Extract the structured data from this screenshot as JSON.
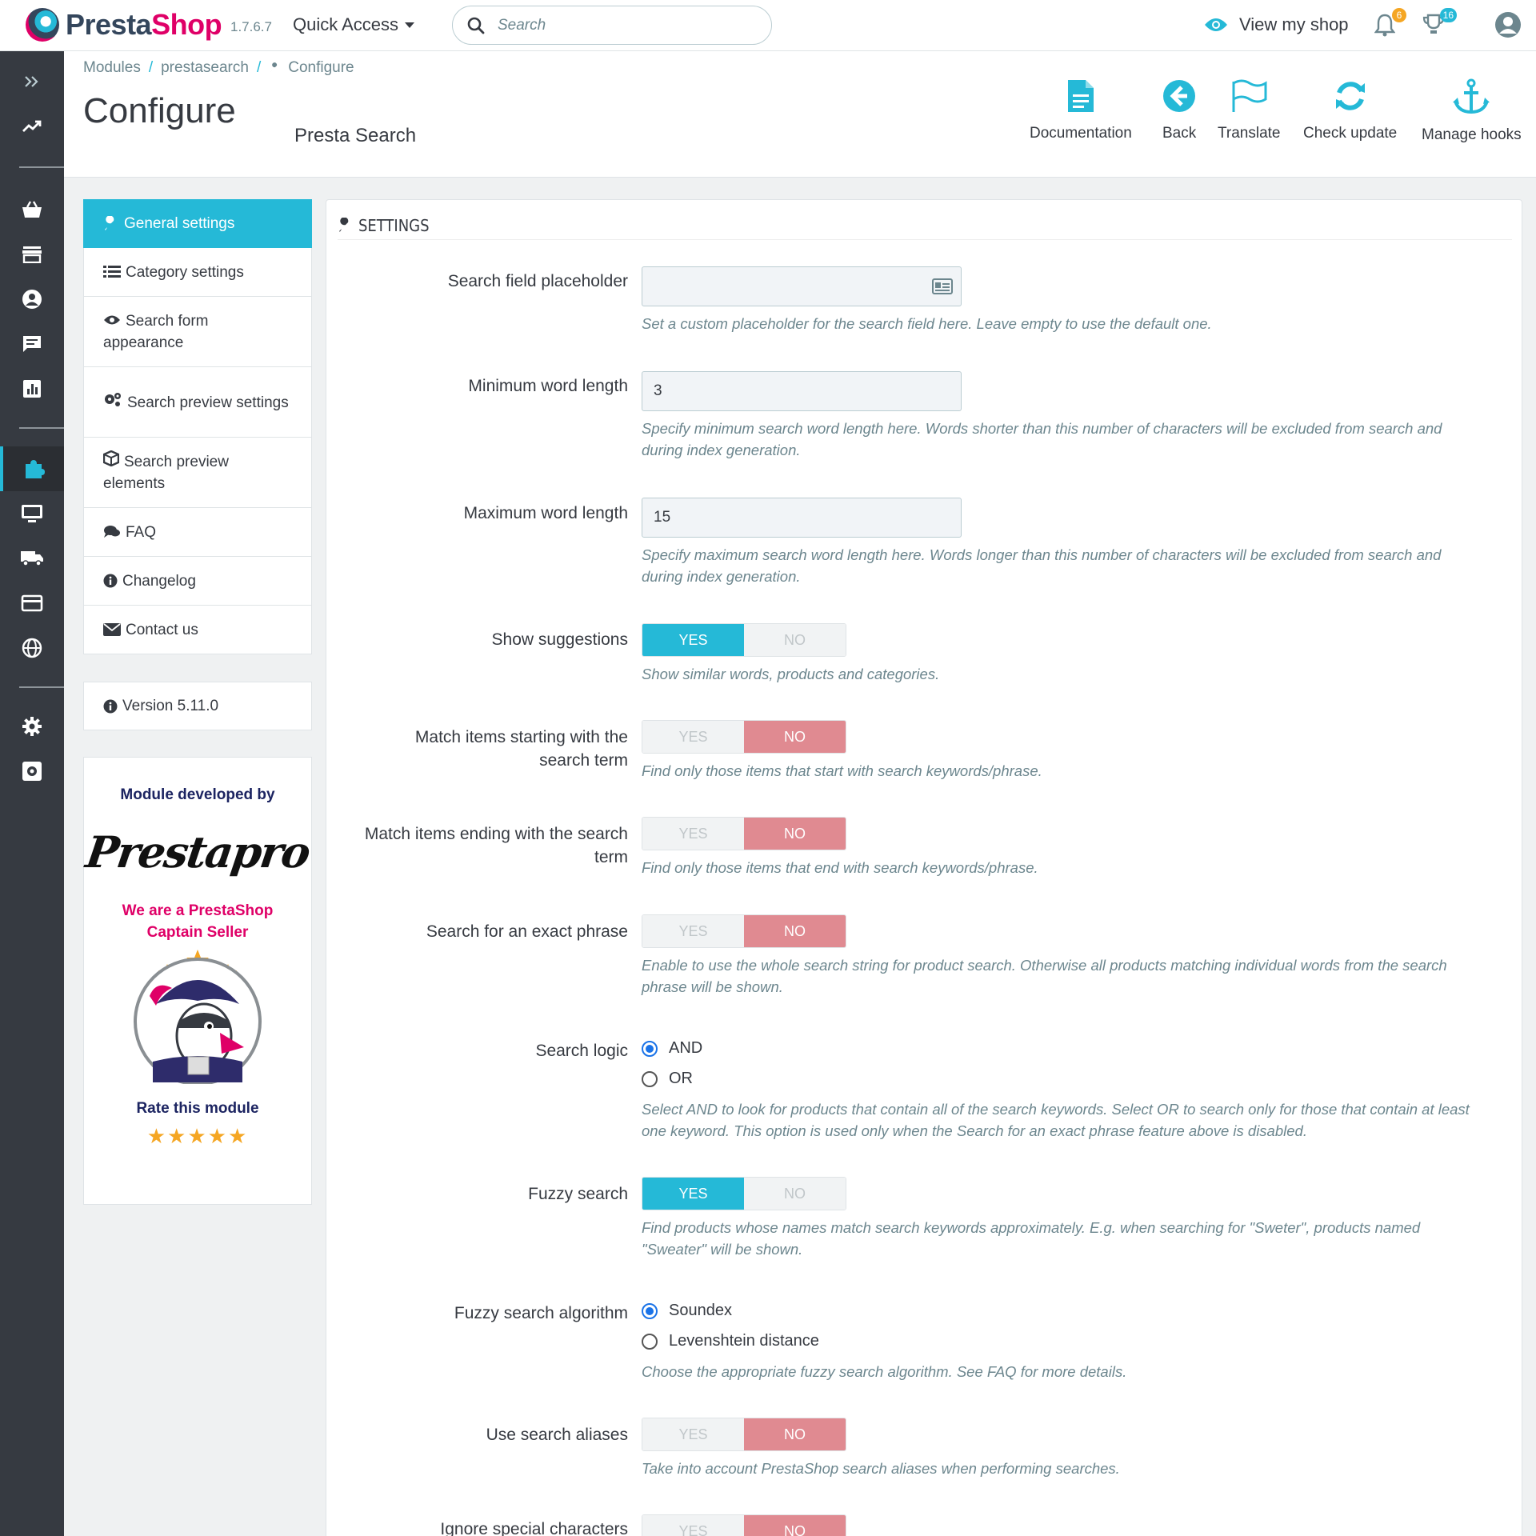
{
  "header": {
    "brand_a": "Presta",
    "brand_b": "Shop",
    "version": "1.7.6.7",
    "quick_access": "Quick Access",
    "search_placeholder": "Search",
    "view_shop": "View my shop",
    "notif_count_orders": "6",
    "notif_count_customers": "16"
  },
  "breadcrumb": [
    "Modules",
    "prestasearch",
    "Configure"
  ],
  "page": {
    "title": "Configure",
    "module_name": "Presta Search"
  },
  "toolbar": {
    "documentation": "Documentation",
    "back": "Back",
    "translate": "Translate",
    "check_update": "Check update",
    "manage_hooks": "Manage hooks"
  },
  "module_nav": [
    {
      "label": "General settings",
      "icon": "wrench-icon"
    },
    {
      "label": "Category settings",
      "icon": "list-icon"
    },
    {
      "label": "Search form appearance",
      "icon": "eye-icon"
    },
    {
      "label": "Search preview settings",
      "icon": "gears-icon"
    },
    {
      "label": "Search preview elements",
      "icon": "cube-icon"
    },
    {
      "label": "FAQ",
      "icon": "comments-icon"
    },
    {
      "label": "Changelog",
      "icon": "info-icon"
    },
    {
      "label": "Contact us",
      "icon": "envelope-icon"
    }
  ],
  "version_label": "Version 5.11.0",
  "developer": {
    "title": "Module developed by",
    "logo_text": "Prestapro",
    "captain_line1": "We are a PrestaShop",
    "captain_line2": "Captain Seller",
    "rate": "Rate this module",
    "stars": "★★★★★"
  },
  "settings": {
    "heading": "SETTINGS",
    "placeholder": {
      "label": "Search field placeholder",
      "value": "",
      "help": "Set a custom placeholder for the search field here. Leave empty to use the default one."
    },
    "min_word": {
      "label": "Minimum word length",
      "value": "3",
      "help_1": "Specify minimum search word length here. Words shorter than this number of characters will be excluded from search and",
      "help_2": "during index generation."
    },
    "max_word": {
      "label": "Maximum word length",
      "value": "15",
      "help_1": "Specify maximum search word length here. Words longer than this number of characters will be excluded from search and",
      "help_2": "during index generation."
    },
    "show_suggestions": {
      "label": "Show suggestions",
      "state": "YES",
      "help": "Show similar words, products and categories."
    },
    "match_start": {
      "label_1": "Match items starting with the",
      "label_2": "search term",
      "state": "NO",
      "help": "Find only those items that start with search keywords/phrase."
    },
    "match_end": {
      "label_1": "Match items ending with the search",
      "label_2": "term",
      "state": "NO",
      "help": "Find only those items that end with search keywords/phrase."
    },
    "exact_phrase": {
      "label": "Search for an exact phrase",
      "state": "NO",
      "help_1": "Enable to use the whole search string for product search. Otherwise all products matching individual words from the search",
      "help_2": "phrase will be shown."
    },
    "search_logic": {
      "label": "Search logic",
      "options": [
        "AND",
        "OR"
      ],
      "selected": "AND",
      "help_1": "Select AND to look for products that contain all of the search keywords. Select OR to search only for those that contain at least",
      "help_2": "one keyword. This option is used only when the Search for an exact phrase feature above is disabled."
    },
    "fuzzy": {
      "label": "Fuzzy search",
      "state": "YES",
      "help_1": "Find products whose names match search keywords approximately. E.g. when searching for \"Sweter\", products named",
      "help_2": "\"Sweater\" will be shown."
    },
    "fuzzy_algo": {
      "label": "Fuzzy search algorithm",
      "options": [
        "Soundex",
        "Levenshtein distance"
      ],
      "selected": "Soundex",
      "help": "Choose the appropriate fuzzy search algorithm. See FAQ for more details."
    },
    "aliases": {
      "label": "Use search aliases",
      "state": "NO",
      "help": "Take into account PrestaShop search aliases when performing searches."
    },
    "ignore_special": {
      "label": "Ignore special characters",
      "state": "NO"
    },
    "yes_label": "YES",
    "no_label": "NO"
  },
  "colors": {
    "accent": "#25b9d7",
    "danger_soft": "#e08a91",
    "sidebar": "#363a41",
    "brand_pink": "#df0067"
  }
}
